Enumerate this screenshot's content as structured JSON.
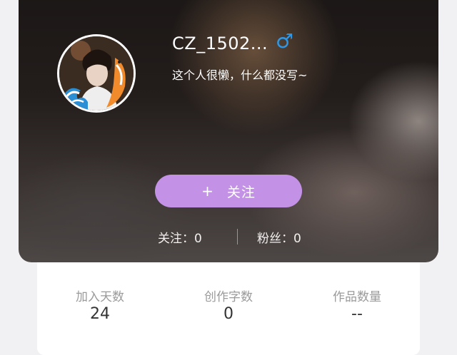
{
  "profile": {
    "username": "CZ_1502...",
    "gender_icon": "♂",
    "bio": "这个人很懒，什么都没写~"
  },
  "actions": {
    "follow_plus": "+",
    "follow_label": "关注"
  },
  "social": {
    "following": "关注：0",
    "fans": "粉丝：0"
  },
  "info": {
    "items": [
      {
        "label": "加入天数",
        "value": "24"
      },
      {
        "label": "创作字数",
        "value": "0"
      },
      {
        "label": "作品数量",
        "value": "--"
      }
    ]
  },
  "colors": {
    "follow_button": "#c392e6",
    "gender_icon": "#2f97e6"
  }
}
